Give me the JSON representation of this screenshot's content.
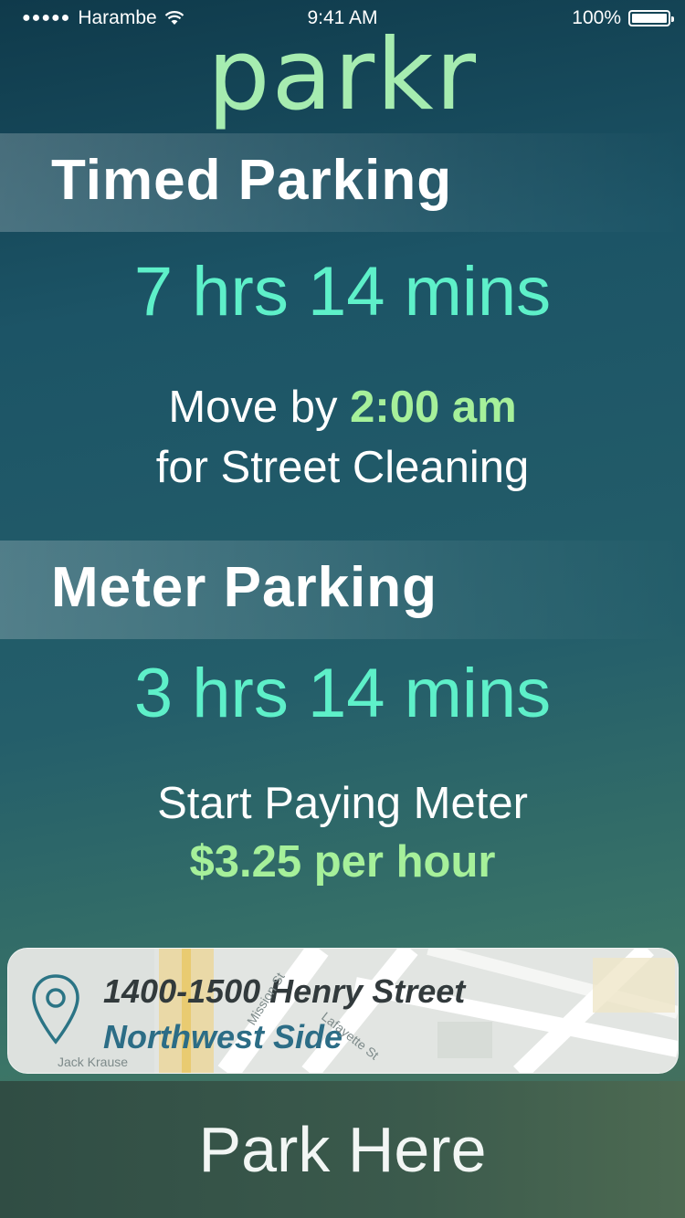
{
  "status_bar": {
    "signal": "●●●●●",
    "carrier": "Harambe",
    "time": "9:41 AM",
    "battery": "100%"
  },
  "app": {
    "logo": "parkr"
  },
  "timed_parking": {
    "title": "Timed Parking",
    "remaining": "7 hrs 14 mins",
    "move_prefix": "Move by",
    "move_time": "2:00 am",
    "reason_prefix": "for",
    "reason": "Street Cleaning"
  },
  "meter_parking": {
    "title": "Meter Parking",
    "remaining": "3 hrs 14 mins",
    "instruction": "Start Paying Meter",
    "rate": "$3.25 per hour"
  },
  "location": {
    "address": "1400-1500 Henry Street",
    "district": "Northwest Side",
    "map_labels": [
      "Jack Krause",
      "Mission St",
      "Lafayette St"
    ]
  },
  "actions": {
    "park_here": "Park Here"
  },
  "colors": {
    "accent_teal": "#5ef0c9",
    "accent_green": "#a6f09a",
    "logo": "#a6ecb0"
  }
}
